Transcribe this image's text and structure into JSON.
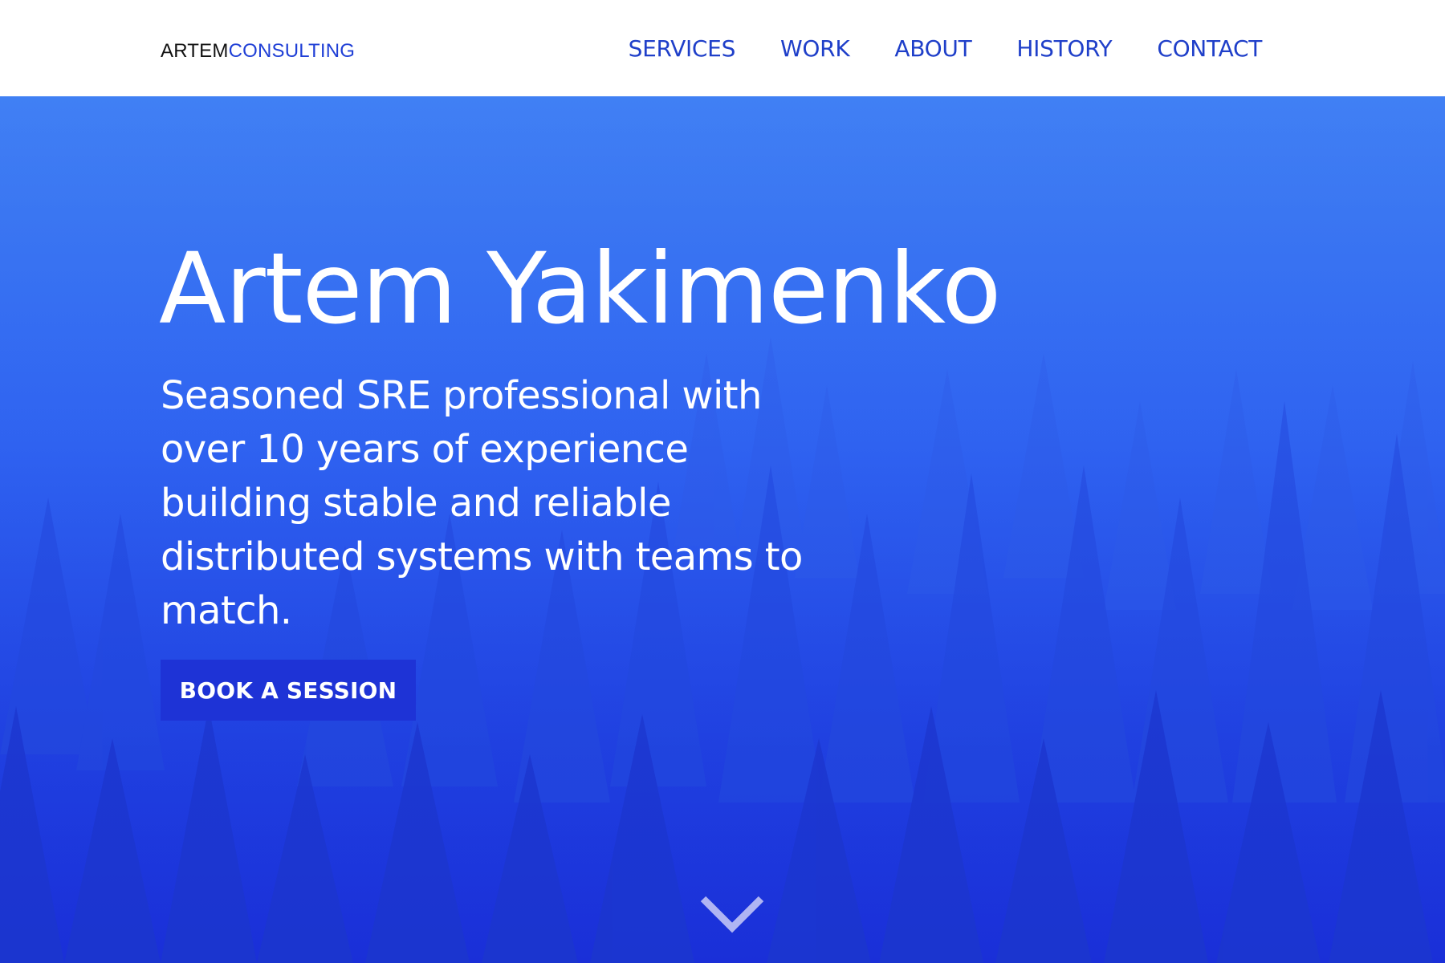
{
  "header": {
    "logo_part1": "ARTEM",
    "logo_part2": "CONSULTING",
    "nav": [
      {
        "label": "SERVICES"
      },
      {
        "label": "WORK"
      },
      {
        "label": "ABOUT"
      },
      {
        "label": "HISTORY"
      },
      {
        "label": "CONTACT"
      }
    ]
  },
  "hero": {
    "title": "Artem Yakimenko",
    "subtitle": "Seasoned SRE professional with over 10 years of experience building stable and reliable distributed systems with teams to match.",
    "cta_label": "BOOK A SESSION",
    "scroll_icon": "chevron-down-icon"
  },
  "colors": {
    "nav_text": "#1f3fc9",
    "logo_accent": "#1f3fd6",
    "hero_top": "#3578f2",
    "hero_bottom": "#1a2fd8",
    "cta_bg": "#1e33d6"
  }
}
